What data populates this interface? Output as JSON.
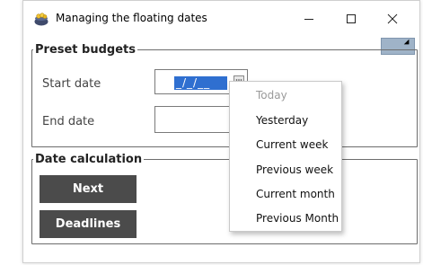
{
  "window": {
    "title": "Managing the floating dates",
    "icon": "pot-of-coins-icon",
    "controls": {
      "minimize": "—",
      "maximize": "☐",
      "close": "✕"
    }
  },
  "preset_budgets": {
    "legend": "Preset budgets",
    "start_date_label": "Start date",
    "start_date_value": "_/_/__",
    "end_date_label": "End date",
    "end_date_value": ""
  },
  "date_calculation": {
    "legend": "Date calculation",
    "next_label": "Next",
    "deadlines_label": "Deadlines"
  },
  "dropdown_menu": {
    "items": [
      {
        "label": "Today",
        "enabled": false
      },
      {
        "label": "Yesterday",
        "enabled": true
      },
      {
        "label": "Current week",
        "enabled": true
      },
      {
        "label": "Previous week",
        "enabled": true
      },
      {
        "label": "Current month",
        "enabled": true
      },
      {
        "label": "Previous Month",
        "enabled": true
      }
    ]
  },
  "colors": {
    "dark_button": "#4b4b4b",
    "selection": "#2f6fd0",
    "corner_button": "#9fb3c8"
  }
}
